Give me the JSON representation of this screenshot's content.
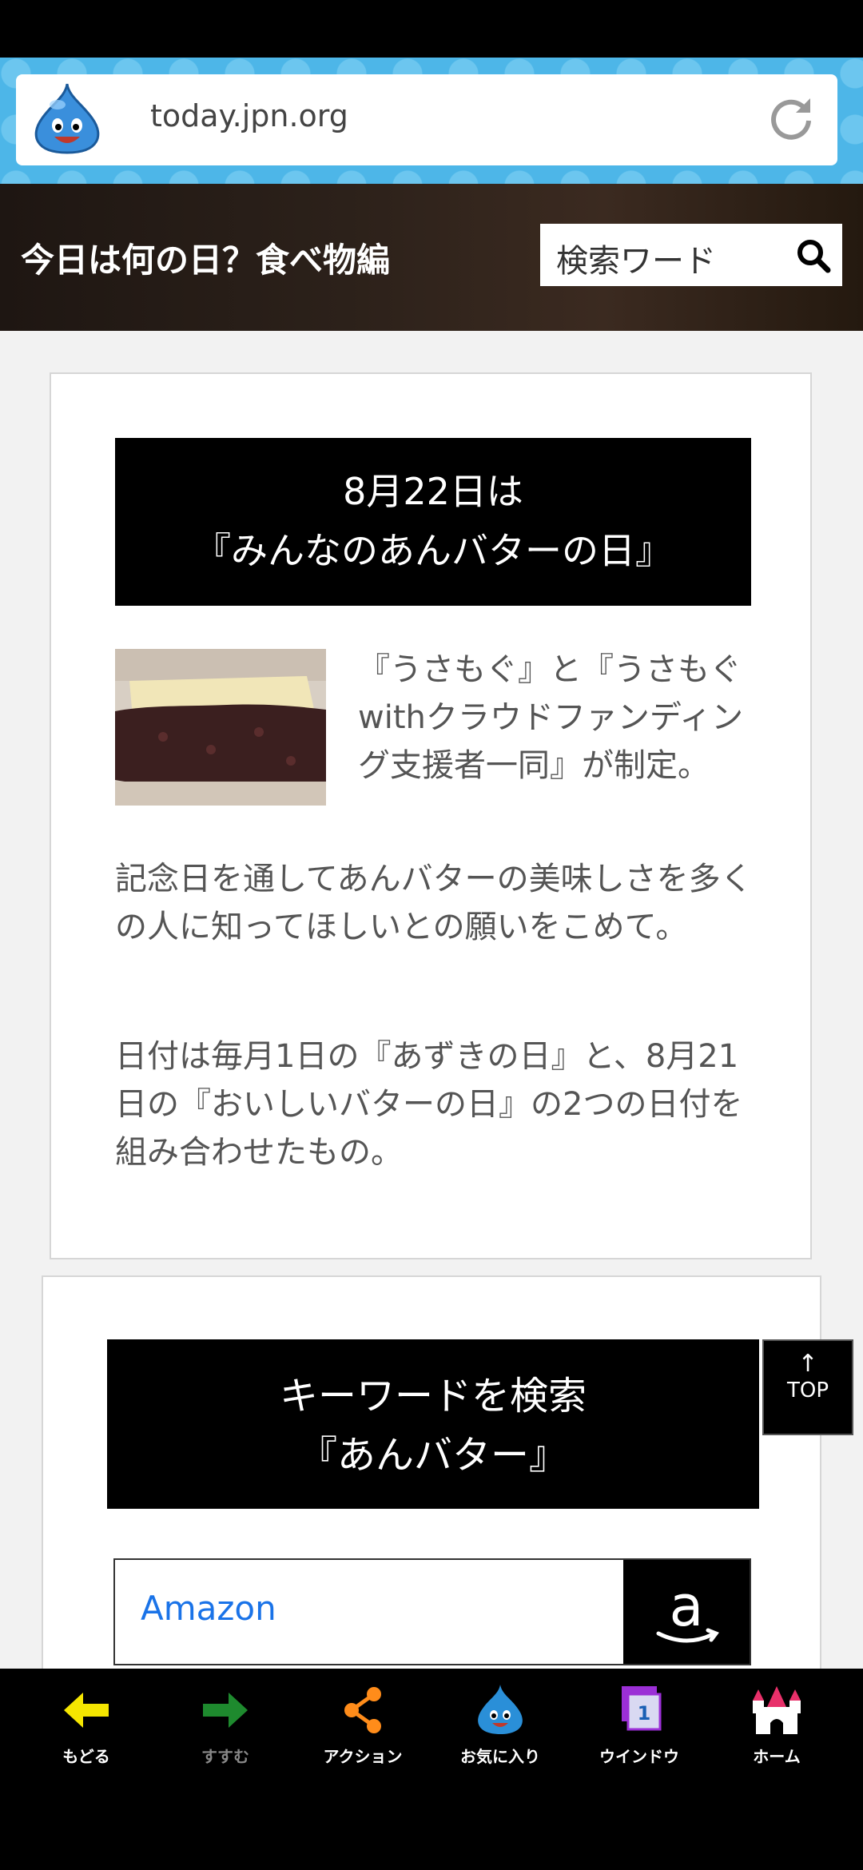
{
  "browser": {
    "url": "today.jpn.org"
  },
  "header": {
    "site_title": "今日は何の日？食べ物編",
    "search_placeholder": "検索ワード"
  },
  "article": {
    "title_line1": "8月22日は",
    "title_line2": "『みんなのあんバターの日』",
    "para1": "『うさもぐ』と『うさもぐwithクラウドファンディング支援者一同』が制定。",
    "para2": "記念日を通してあんバターの美味しさを多くの人に知ってほしいとの願いをこめて。",
    "para3": "日付は毎月1日の『あずきの日』と、8月21日の『おいしいバターの日』の2つの日付を組み合わせたもの。"
  },
  "keyword": {
    "line1": "キーワードを検索",
    "line2": "『あんバター』"
  },
  "amazon": {
    "label": "Amazon"
  },
  "top_button": {
    "arrow": "↑",
    "label": "TOP"
  },
  "bottom_nav": [
    {
      "label": "もどる",
      "icon": "back-arrow-icon",
      "color": "#f5e600"
    },
    {
      "label": "すすむ",
      "icon": "forward-arrow-icon",
      "color": "#1e8a2e"
    },
    {
      "label": "アクション",
      "icon": "share-icon",
      "color": "#ff8c1a"
    },
    {
      "label": "お気に入り",
      "icon": "slime-favorite-icon",
      "color": "#2a8fd8"
    },
    {
      "label": "ウインドウ",
      "icon": "window-icon",
      "color": "#9b2fd6",
      "badge": "1"
    },
    {
      "label": "ホーム",
      "icon": "castle-home-icon",
      "color": "#e8306a"
    }
  ]
}
